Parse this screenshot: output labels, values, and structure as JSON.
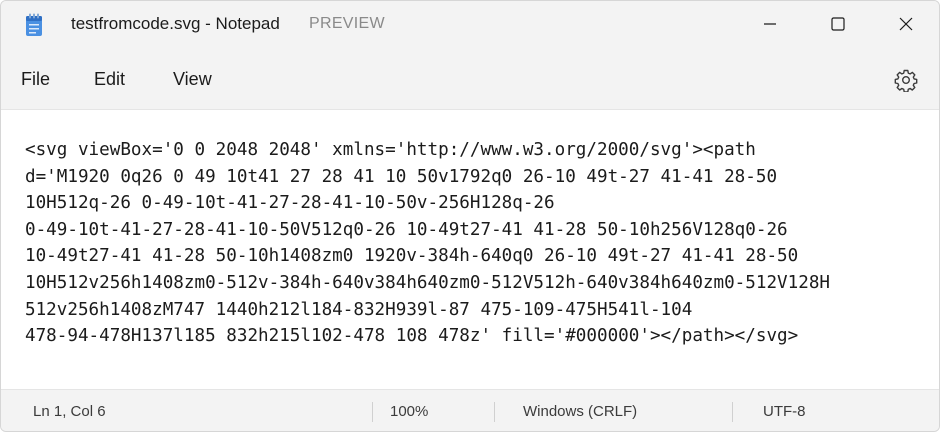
{
  "window": {
    "title": "testfromcode.svg - Notepad",
    "preview_label": "PREVIEW",
    "app_icon": "notepad-icon",
    "controls": [
      "minimize-icon",
      "maximize-icon",
      "close-icon"
    ]
  },
  "menu": {
    "file": "File",
    "edit": "Edit",
    "view": "View",
    "settings_icon": "gear-icon"
  },
  "editor": {
    "lines": [
      "<svg viewBox='0 0 2048 2048' xmlns='http://www.w3.org/2000/svg'><path",
      "d='M1920 0q26 0 49 10t41 27 28 41 10 50v1792q0 26-10 49t-27 41-41 28-50",
      "10H512q-26 0-49-10t-41-27-28-41-10-50v-256H128q-26",
      "0-49-10t-41-27-28-41-10-50V512q0-26 10-49t27-41 41-28 50-10h256V128q0-26",
      "10-49t27-41 41-28 50-10h1408zm0 1920v-384h-640q0 26-10 49t-27 41-41 28-50",
      "10H512v256h1408zm0-512v-384h-640v384h640zm0-512V512h-640v384h640zm0-512V128H",
      "512v256h1408zM747 1440h212l184-832H939l-87 475-109-475H541l-104",
      "478-94-478H137l185 832h215l102-478 108 478z' fill='#000000'></path></svg>"
    ]
  },
  "status": {
    "position": "Ln 1, Col 6",
    "zoom": "100%",
    "line_endings": "Windows (CRLF)",
    "encoding": "UTF-8"
  },
  "colors": {
    "chrome": "#f3f3f3",
    "editor_bg": "#ffffff",
    "icon_blue": "#2f6fc4"
  }
}
